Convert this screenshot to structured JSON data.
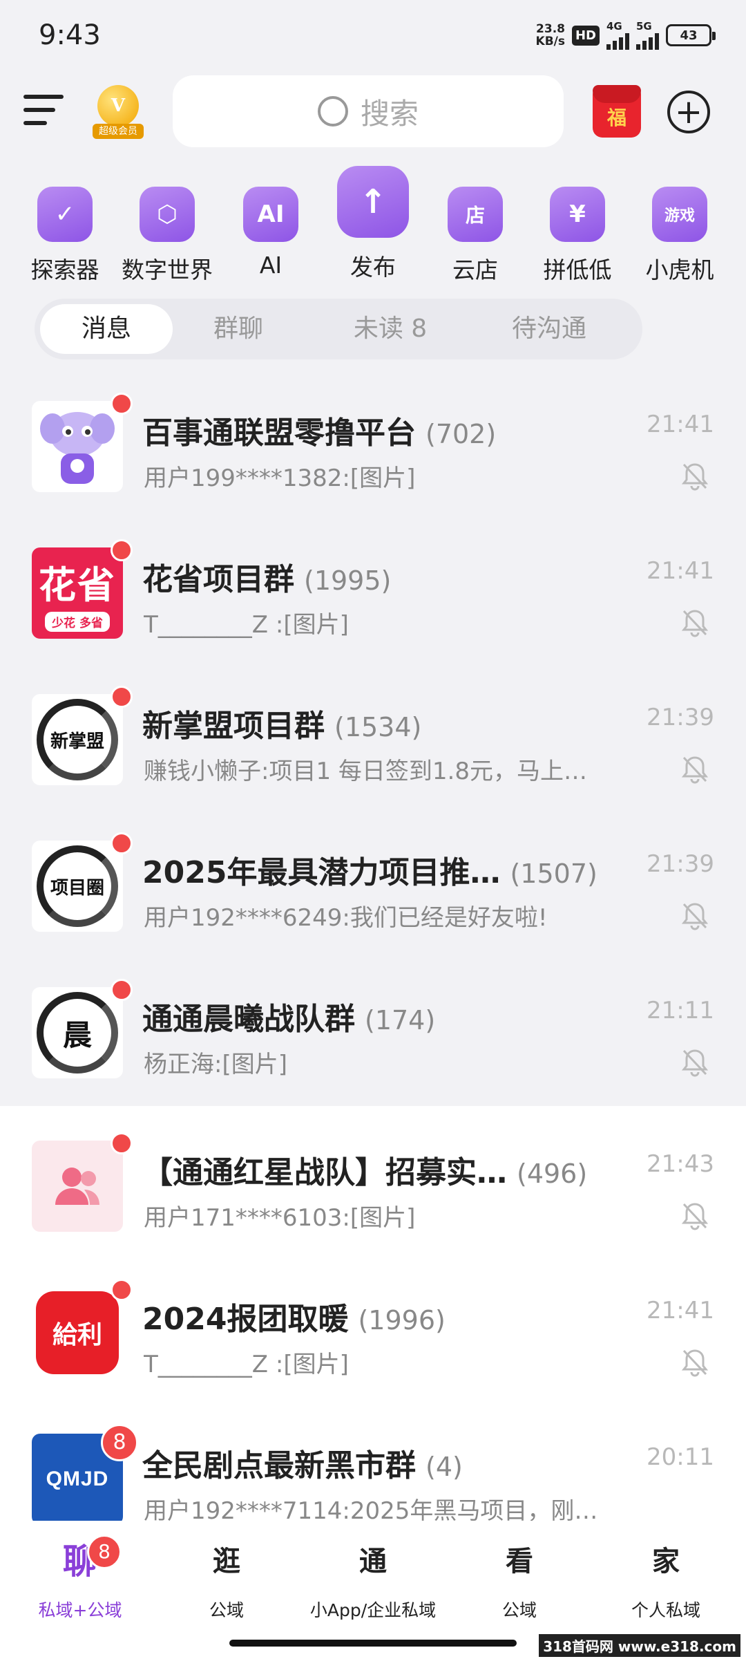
{
  "status_bar": {
    "time": "9:43",
    "net_speed_value": "23.8",
    "net_speed_unit": "KB/s",
    "hd_label": "HD",
    "signal_1_label": "4G",
    "signal_2_label": "5G",
    "battery": "43"
  },
  "top_bar": {
    "vip_label": "超级会员",
    "vip_letter": "V",
    "search_placeholder": "搜索",
    "redpacket_glyph": "福"
  },
  "quick_apps": [
    {
      "label": "探索器",
      "icon": "compass-icon",
      "glyph": "✓"
    },
    {
      "label": "数字世界",
      "icon": "cube-icon",
      "glyph": "⬡"
    },
    {
      "label": "AI",
      "icon": "ai-icon",
      "glyph": "AI"
    },
    {
      "label": "发布",
      "icon": "upload-icon",
      "glyph": "↑"
    },
    {
      "label": "云店",
      "icon": "store-icon",
      "glyph": "店"
    },
    {
      "label": "拼低低",
      "icon": "discount-icon",
      "glyph": "¥"
    },
    {
      "label": "小虎机",
      "icon": "game-icon",
      "glyph": "游戏"
    }
  ],
  "tabs": [
    {
      "label": "消息",
      "active": true
    },
    {
      "label": "群聊",
      "active": false
    },
    {
      "label": "未读 8",
      "active": false
    },
    {
      "label": "待沟通",
      "active": false
    }
  ],
  "chats": [
    {
      "name": "百事通联盟零撸平台",
      "count": "(702)",
      "message": "用户199****1382:[图片]",
      "time": "21:41",
      "avatar": "mascot",
      "badge": ""
    },
    {
      "name": "花省项目群",
      "count": "(1995)",
      "message": "T________Z :[图片]",
      "time": "21:41",
      "avatar": "huasheng",
      "avatar_text": "花省",
      "avatar_sub": "少花 多省",
      "badge": ""
    },
    {
      "name": "新掌盟项目群",
      "count": "(1534)",
      "message": "赚钱小懒子:项目1 每日签到1.8元，马上…",
      "time": "21:39",
      "avatar": "ink",
      "avatar_text": "新掌盟",
      "badge": ""
    },
    {
      "name": "2025年最具潜力项目推…",
      "count": "(1507)",
      "message": "用户192****6249:我们已经是好友啦!",
      "time": "21:39",
      "avatar": "ink",
      "avatar_text": "项目圈",
      "badge": ""
    },
    {
      "name": "通通晨曦战队群",
      "count": "(174)",
      "message": "杨正海:[图片]",
      "time": "21:11",
      "avatar": "ink",
      "avatar_text": "晨",
      "badge": ""
    },
    {
      "name": "【通通红星战队】招募实…",
      "count": "(496)",
      "message": "用户171****6103:[图片]",
      "time": "21:43",
      "avatar": "group",
      "badge": ""
    },
    {
      "name": "2024报团取暖",
      "count": "(1996)",
      "message": "T________Z :[图片]",
      "time": "21:41",
      "avatar": "geili",
      "avatar_text": "給利",
      "badge": ""
    },
    {
      "name": "全民剧点最新黑市群",
      "count": "(4)",
      "message": "用户192****7114:2025年黑马项目，刚…",
      "time": "20:11",
      "avatar": "qmjd",
      "avatar_text": "QMJD",
      "badge": "8"
    }
  ],
  "bottom_nav": [
    {
      "glyph": "聊",
      "label": "私域+公域",
      "active": true,
      "badge": "8"
    },
    {
      "glyph": "逛",
      "label": "公域",
      "active": false
    },
    {
      "glyph": "通",
      "label": "小App/企业私域",
      "active": false
    },
    {
      "glyph": "看",
      "label": "公域",
      "active": false
    },
    {
      "glyph": "家",
      "label": "个人私域",
      "active": false
    }
  ],
  "watermark": "318首码网 www.e318.com",
  "colors": {
    "accent": "#8a3fd8",
    "badge": "#f04848",
    "background": "#f2f2f5"
  }
}
